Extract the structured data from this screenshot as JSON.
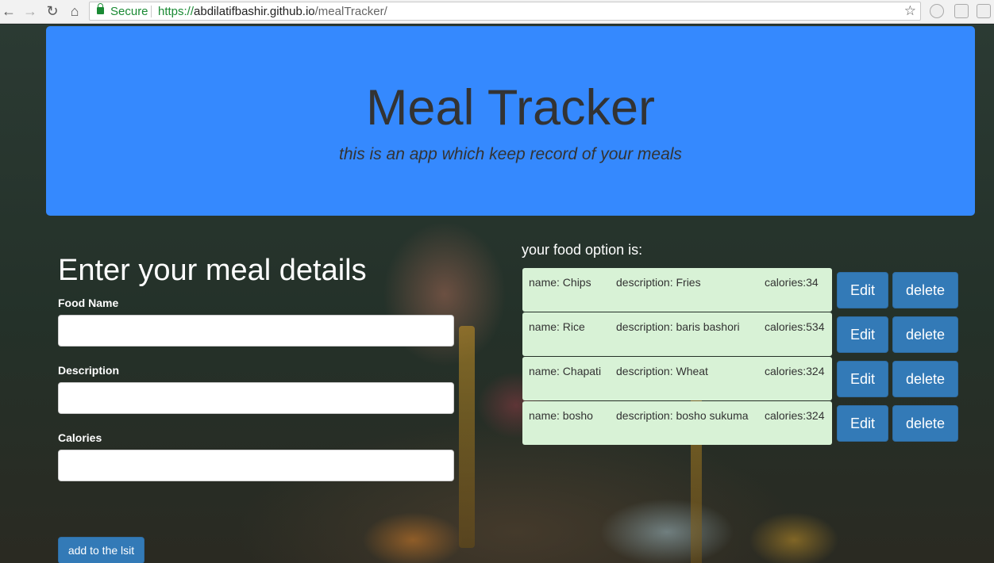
{
  "browser": {
    "secure_label": "Secure",
    "url_scheme": "https://",
    "url_host": "abdilatifbashir.github.io",
    "url_path": "/mealTracker/"
  },
  "header": {
    "title": "Meal Tracker",
    "subtitle": "this is an app which keep record of your meals"
  },
  "form": {
    "title": "Enter your meal details",
    "food_name_label": "Food Name",
    "description_label": "Description",
    "calories_label": "Calories",
    "food_name_value": "",
    "description_value": "",
    "calories_value": "",
    "submit_label": "add to the lsit"
  },
  "list": {
    "title": "your food option is:",
    "edit_label": "Edit",
    "delete_label": "delete",
    "items": [
      {
        "name": "name: Chips",
        "description": "description: Fries",
        "calories": "calories:34"
      },
      {
        "name": "name: Rice",
        "description": "description: baris bashori",
        "calories": "calories:534"
      },
      {
        "name": "name: Chapati",
        "description": "description: Wheat",
        "calories": "calories:324"
      },
      {
        "name": "name: bosho",
        "description": "description: bosho sukuma",
        "calories": "calories:324"
      }
    ]
  },
  "colors": {
    "jumbotron": "#3589fe",
    "row_background": "#d8f2d6",
    "button": "#337ab7"
  }
}
